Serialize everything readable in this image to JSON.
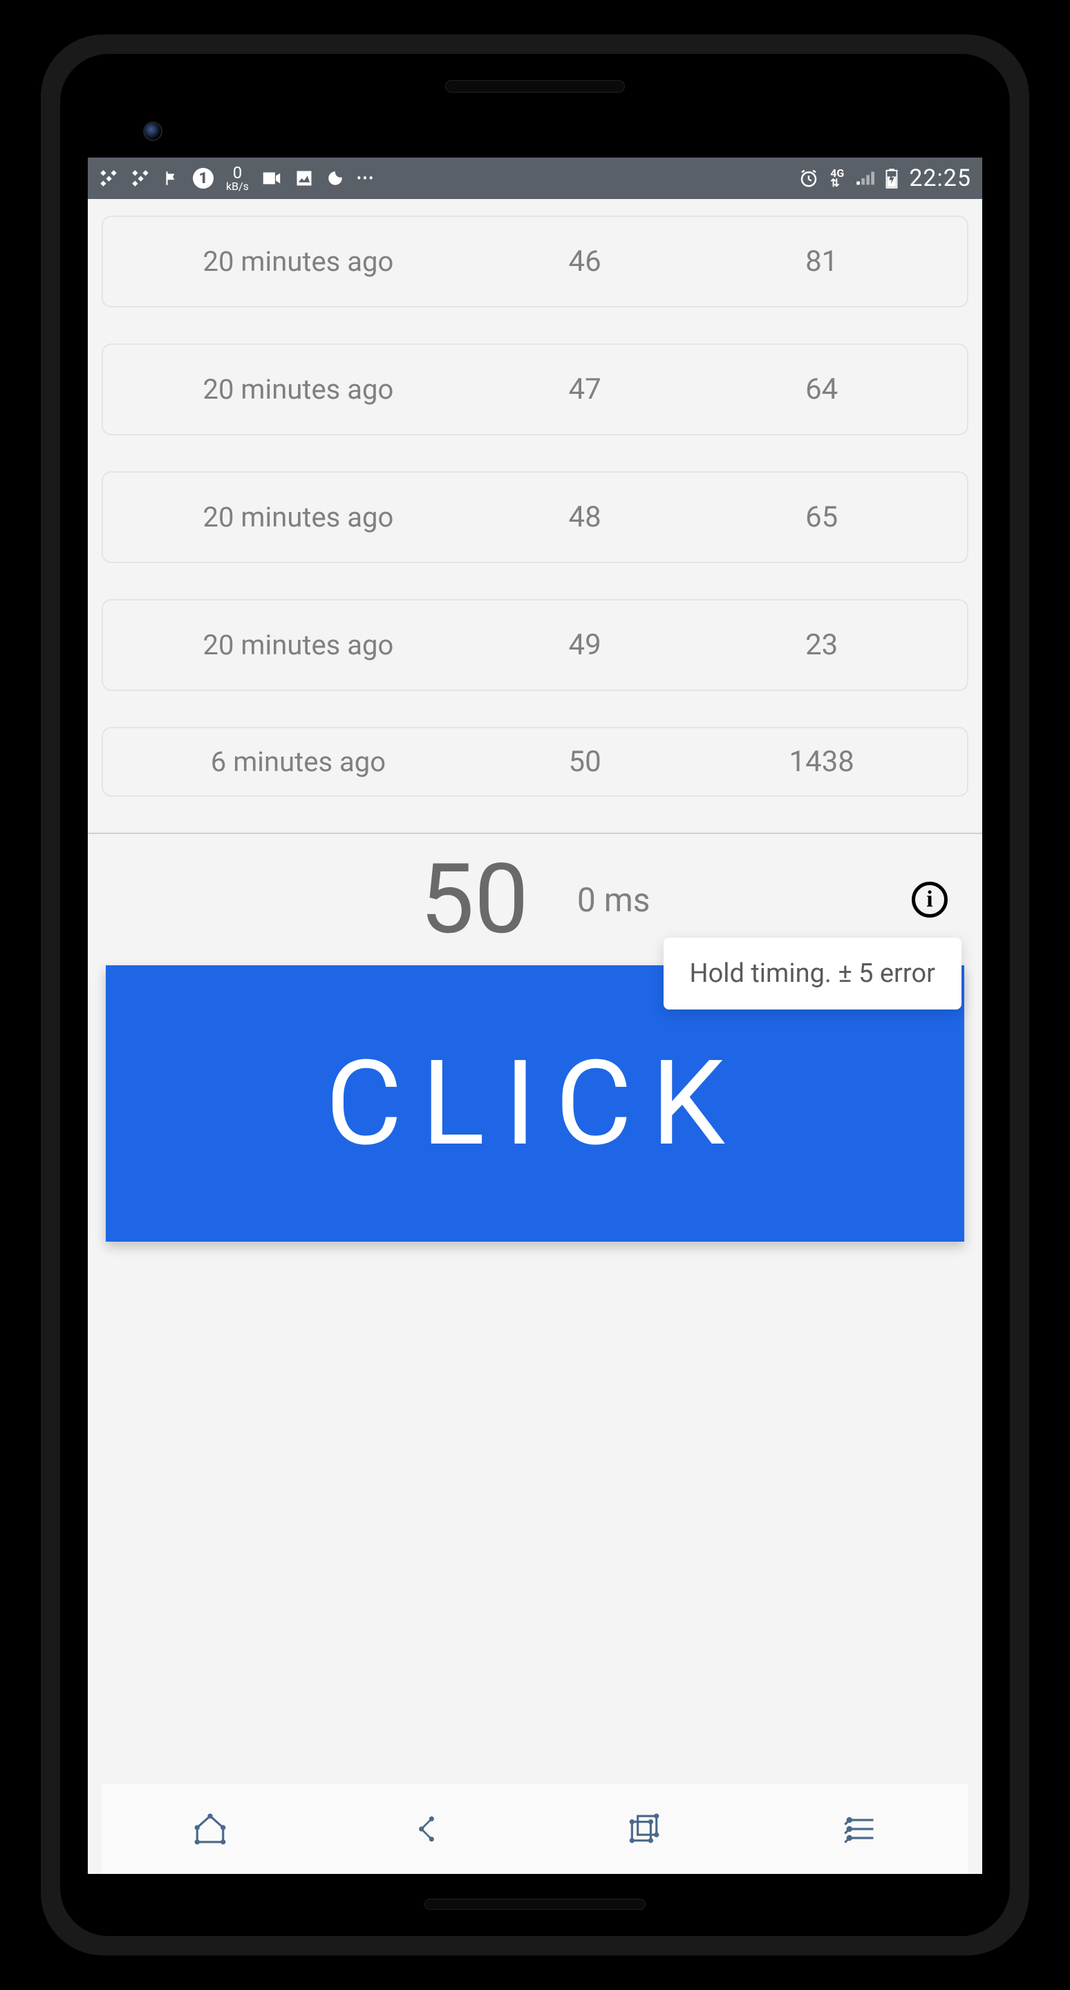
{
  "status_bar": {
    "kbps_value": "0",
    "kbps_unit": "kB/s",
    "network_label": "4G",
    "time": "22:25"
  },
  "history": [
    {
      "time": "20 minutes ago",
      "val1": "46",
      "val2": "81"
    },
    {
      "time": "20 minutes ago",
      "val1": "47",
      "val2": "64"
    },
    {
      "time": "20 minutes ago",
      "val1": "48",
      "val2": "65"
    },
    {
      "time": "20 minutes ago",
      "val1": "49",
      "val2": "23"
    },
    {
      "time": "6 minutes ago",
      "val1": "50",
      "val2": "1438"
    }
  ],
  "current": {
    "number": "50",
    "ms": "0 ms"
  },
  "tooltip": "Hold timing. ± 5 error",
  "button_label": "CLICK"
}
